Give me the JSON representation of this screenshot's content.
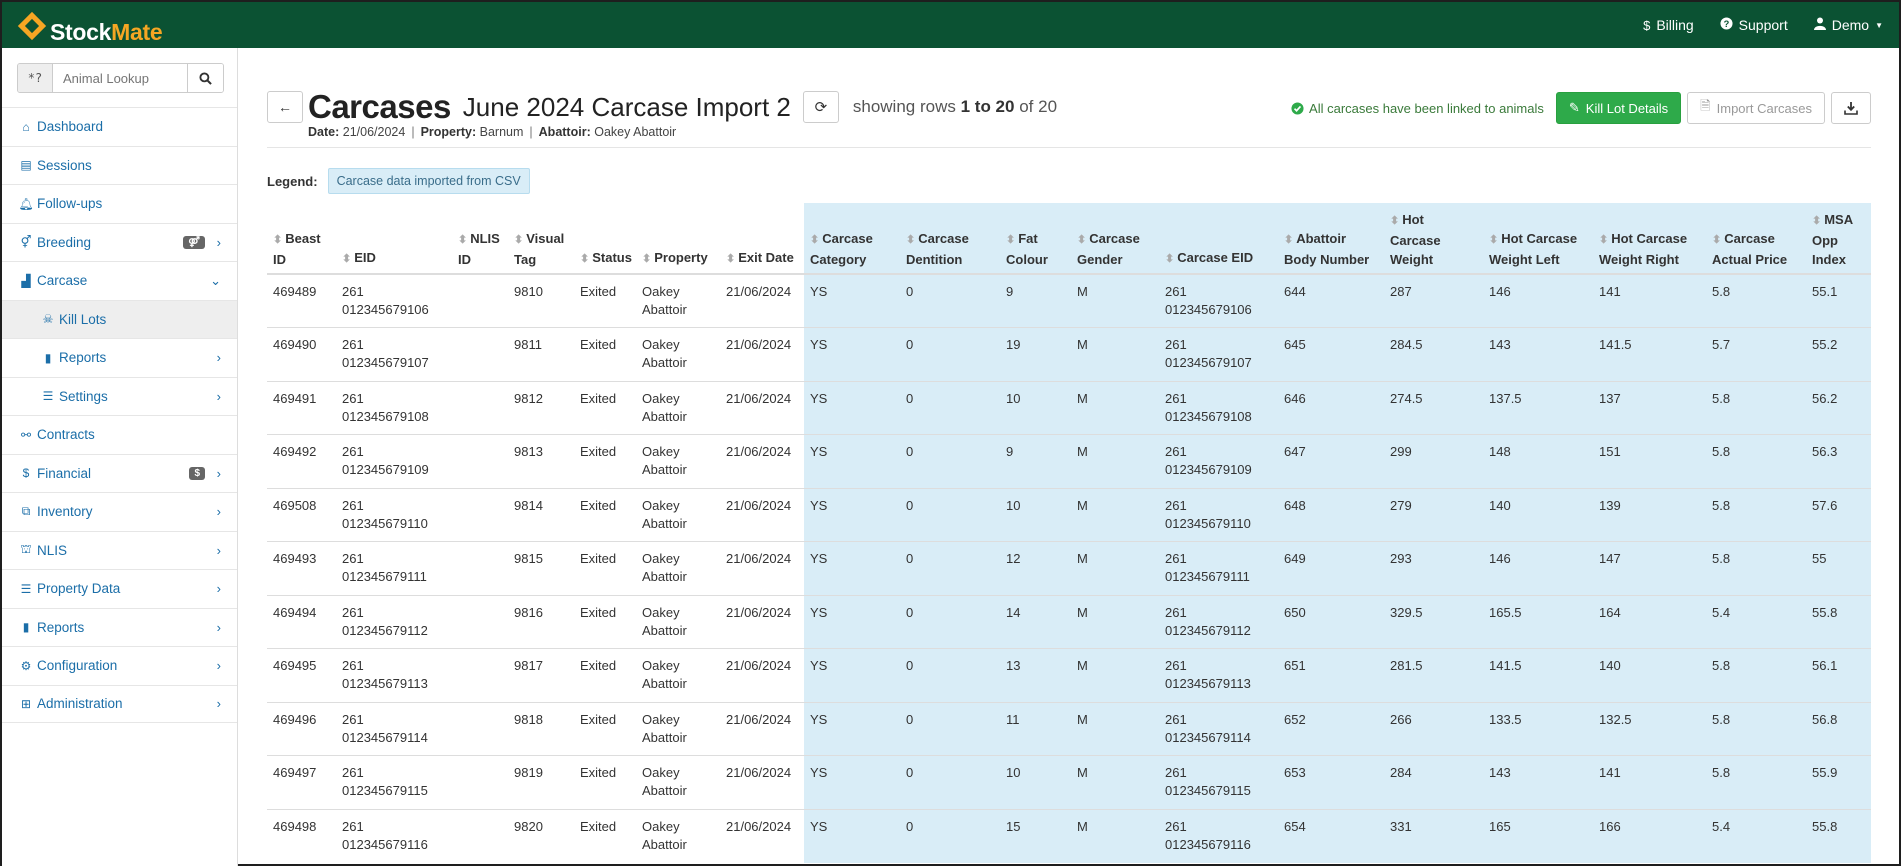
{
  "brand": {
    "name_a": "Stock",
    "name_b": "Mate"
  },
  "topnav": {
    "billing": "Billing",
    "support": "Support",
    "user": "Demo"
  },
  "lookup": {
    "prefix": "*?",
    "placeholder": "Animal Lookup"
  },
  "sidebar": {
    "items": [
      {
        "label": "Dashboard",
        "icon": "home-icon"
      },
      {
        "label": "Sessions",
        "icon": "table-icon"
      },
      {
        "label": "Follow-ups",
        "icon": "bell-icon"
      },
      {
        "label": "Breeding",
        "icon": "breeding-icon"
      },
      {
        "label": "Carcase",
        "icon": "area-chart-icon"
      },
      {
        "label": "Kill Lots",
        "icon": "skull-icon"
      },
      {
        "label": "Reports",
        "icon": "bar-chart-icon"
      },
      {
        "label": "Settings",
        "icon": "sliders-icon"
      },
      {
        "label": "Contracts",
        "icon": "handshake-icon"
      },
      {
        "label": "Financial",
        "icon": "dollar-icon",
        "badge": "$"
      },
      {
        "label": "Inventory",
        "icon": "cubes-icon"
      },
      {
        "label": "NLIS",
        "icon": "bank-icon"
      },
      {
        "label": "Property Data",
        "icon": "sliders-icon"
      },
      {
        "label": "Reports",
        "icon": "bar-chart-icon"
      },
      {
        "label": "Configuration",
        "icon": "gear-icon"
      },
      {
        "label": "Administration",
        "icon": "sitemap-icon"
      }
    ]
  },
  "header": {
    "title": "Carcases",
    "subtitle": "June 2024 Carcase Import 2",
    "rows_prefix": "showing rows",
    "rows_range": "1 to 20",
    "rows_of": "of",
    "rows_total": "20",
    "date_label": "Date:",
    "date": "21/06/2024",
    "property_label": "Property:",
    "property": "Barnum",
    "abattoir_label": "Abattoir:",
    "abattoir": "Oakey Abattoir"
  },
  "actions": {
    "linked_msg": "All carcases have been linked to animals",
    "kill_lot": "Kill Lot Details",
    "import": "Import Carcases"
  },
  "legend": {
    "label": "Legend:",
    "chip": "Carcase data imported from CSV"
  },
  "colors": {
    "topbar": "#0b5233",
    "accent": "#f5a623",
    "link": "#1b6ea8",
    "csv_bg": "#d9edf7",
    "success": "#2eaa4a"
  },
  "table": {
    "headers": [
      {
        "l1": "Beast",
        "l2": "ID",
        "sort": true
      },
      {
        "l1": "",
        "l2": "EID",
        "sort": true
      },
      {
        "l1": "NLIS",
        "l2": "ID",
        "sort": true
      },
      {
        "l1": "Visual",
        "l2": "Tag",
        "sort": true
      },
      {
        "l1": "",
        "l2": "Status",
        "sort": true
      },
      {
        "l1": "",
        "l2": "Property",
        "sort": true
      },
      {
        "l1": "",
        "l2": "Exit Date",
        "sort": true
      },
      {
        "l1": "Carcase",
        "l2": "Category",
        "sort": true,
        "csv": true
      },
      {
        "l1": "Carcase",
        "l2": "Dentition",
        "sort": true,
        "csv": true
      },
      {
        "l1": "Fat",
        "l2": "Colour",
        "sort": true,
        "csv": true
      },
      {
        "l1": "Carcase",
        "l2": "Gender",
        "sort": true,
        "csv": true
      },
      {
        "l1": "",
        "l2": "Carcase EID",
        "sort": true,
        "csv": true
      },
      {
        "l1": "Abattoir",
        "l2": "Body Number",
        "sort": true,
        "csv": true
      },
      {
        "l0": "Hot",
        "l1": "Carcase",
        "l2": "Weight",
        "sort": true,
        "csv": true
      },
      {
        "l1": "Hot Carcase",
        "l2": "Weight Left",
        "sort": true,
        "csv": true
      },
      {
        "l1": "Hot Carcase",
        "l2": "Weight Right",
        "sort": true,
        "csv": true
      },
      {
        "l1": "Carcase",
        "l2": "Actual Price",
        "sort": true,
        "csv": true
      },
      {
        "l1": "MSA",
        "l2": "Opp Index",
        "sort": true,
        "csv": true
      }
    ],
    "rows": [
      [
        "469489",
        "261|012345679106",
        "",
        "9810",
        "Exited",
        "Oakey|Abattoir",
        "21/06/2024",
        "YS",
        "0",
        "9",
        "M",
        "261|012345679106",
        "644",
        "287",
        "146",
        "141",
        "5.8",
        "55.1"
      ],
      [
        "469490",
        "261|012345679107",
        "",
        "9811",
        "Exited",
        "Oakey|Abattoir",
        "21/06/2024",
        "YS",
        "0",
        "19",
        "M",
        "261|012345679107",
        "645",
        "284.5",
        "143",
        "141.5",
        "5.7",
        "55.2"
      ],
      [
        "469491",
        "261|012345679108",
        "",
        "9812",
        "Exited",
        "Oakey|Abattoir",
        "21/06/2024",
        "YS",
        "0",
        "10",
        "M",
        "261|012345679108",
        "646",
        "274.5",
        "137.5",
        "137",
        "5.8",
        "56.2"
      ],
      [
        "469492",
        "261|012345679109",
        "",
        "9813",
        "Exited",
        "Oakey|Abattoir",
        "21/06/2024",
        "YS",
        "0",
        "9",
        "M",
        "261|012345679109",
        "647",
        "299",
        "148",
        "151",
        "5.8",
        "56.3"
      ],
      [
        "469508",
        "261|012345679110",
        "",
        "9814",
        "Exited",
        "Oakey|Abattoir",
        "21/06/2024",
        "YS",
        "0",
        "10",
        "M",
        "261|012345679110",
        "648",
        "279",
        "140",
        "139",
        "5.8",
        "57.6"
      ],
      [
        "469493",
        "261|012345679111",
        "",
        "9815",
        "Exited",
        "Oakey|Abattoir",
        "21/06/2024",
        "YS",
        "0",
        "12",
        "M",
        "261|012345679111",
        "649",
        "293",
        "146",
        "147",
        "5.8",
        "55"
      ],
      [
        "469494",
        "261|012345679112",
        "",
        "9816",
        "Exited",
        "Oakey|Abattoir",
        "21/06/2024",
        "YS",
        "0",
        "14",
        "M",
        "261|012345679112",
        "650",
        "329.5",
        "165.5",
        "164",
        "5.4",
        "55.8"
      ],
      [
        "469495",
        "261|012345679113",
        "",
        "9817",
        "Exited",
        "Oakey|Abattoir",
        "21/06/2024",
        "YS",
        "0",
        "13",
        "M",
        "261|012345679113",
        "651",
        "281.5",
        "141.5",
        "140",
        "5.8",
        "56.1"
      ],
      [
        "469496",
        "261|012345679114",
        "",
        "9818",
        "Exited",
        "Oakey|Abattoir",
        "21/06/2024",
        "YS",
        "0",
        "11",
        "M",
        "261|012345679114",
        "652",
        "266",
        "133.5",
        "132.5",
        "5.8",
        "56.8"
      ],
      [
        "469497",
        "261|012345679115",
        "",
        "9819",
        "Exited",
        "Oakey|Abattoir",
        "21/06/2024",
        "YS",
        "0",
        "10",
        "M",
        "261|012345679115",
        "653",
        "284",
        "143",
        "141",
        "5.8",
        "55.9"
      ],
      [
        "469498",
        "261|012345679116",
        "",
        "9820",
        "Exited",
        "Oakey|Abattoir",
        "21/06/2024",
        "YS",
        "0",
        "15",
        "M",
        "261|012345679116",
        "654",
        "331",
        "165",
        "166",
        "5.4",
        "55.8"
      ]
    ]
  }
}
